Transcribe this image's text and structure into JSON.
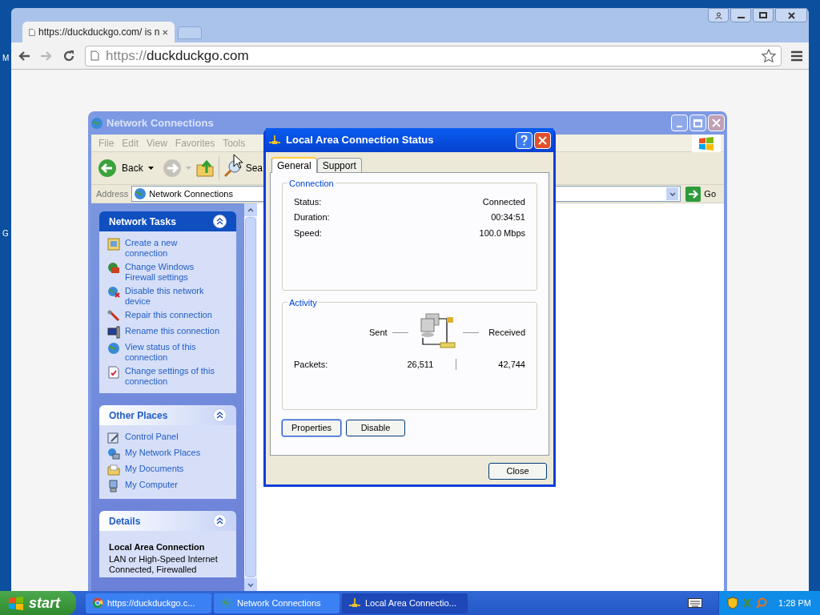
{
  "desktop": {
    "icon_labels": [
      "M",
      "G"
    ]
  },
  "browser": {
    "tabs": [
      {
        "title": "https://duckduckgo.com/ is n",
        "selected": true
      }
    ],
    "address_scheme": "https://",
    "address_host": "duckduckgo.com"
  },
  "explorer": {
    "title": "Network Connections",
    "menu": [
      "File",
      "Edit",
      "View",
      "Favorites",
      "Tools"
    ],
    "back": "Back",
    "search": "Sea",
    "address_label": "Address",
    "address": "Network Connections",
    "go": "Go",
    "panes": [
      {
        "title": "Network Tasks",
        "kind": "special",
        "items": [
          "Create a new connection",
          "Change Windows Firewall settings",
          "Disable this network device",
          "Repair this connection",
          "Rename this connection",
          "View status of this connection",
          "Change settings of this connection"
        ]
      },
      {
        "title": "Other Places",
        "kind": "normal",
        "items": [
          "Control Panel",
          "My Network Places",
          "My Documents",
          "My Computer"
        ]
      }
    ],
    "details": {
      "title": "Details",
      "name": "Local Area Connection",
      "lines": [
        "LAN or High-Speed Internet",
        "Connected, Firewalled"
      ]
    }
  },
  "dialog": {
    "title": "Local Area Connection Status",
    "tabs": [
      {
        "label": "General",
        "selected": true
      },
      {
        "label": "Support",
        "selected": false
      }
    ],
    "connection": {
      "title": "Connection",
      "rows": [
        {
          "label": "Status:",
          "value": "Connected"
        },
        {
          "label": "Duration:",
          "value": "00:34:51"
        },
        {
          "label": "Speed:",
          "value": "100.0 Mbps"
        }
      ]
    },
    "activity": {
      "title": "Activity",
      "sent": "Sent",
      "received": "Received",
      "packets_label": "Packets:",
      "packets_sent": "26,511",
      "packets_received": "42,744"
    },
    "buttons": [
      {
        "label": "Properties",
        "default": true
      },
      {
        "label": "Disable",
        "default": false
      }
    ],
    "close": "Close"
  },
  "taskbar": {
    "start": "start",
    "items": [
      {
        "label": "https://duckduckgo.c...",
        "selected": false
      },
      {
        "label": "Network Connections",
        "selected": false
      },
      {
        "label": "Local Area Connectio...",
        "selected": true
      }
    ],
    "time": "1:28 PM"
  }
}
